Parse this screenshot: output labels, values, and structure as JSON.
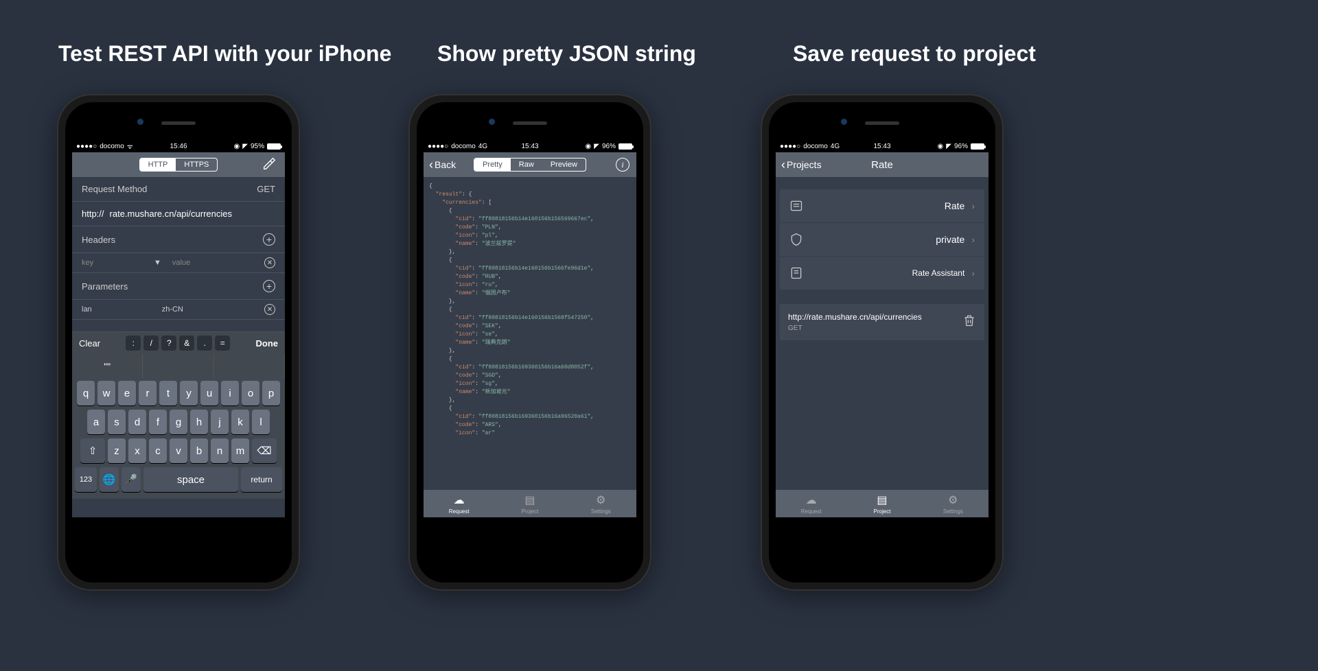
{
  "captions": {
    "c1": "Test REST API with your iPhone",
    "c2": "Show pretty JSON string",
    "c3": "Save request to project"
  },
  "statusbar": {
    "carrier": "docomo",
    "wifi": "wifi",
    "net4g": "4G",
    "time1": "15:46",
    "time2": "15:43",
    "time3": "15:43",
    "battery1": "95%",
    "battery2": "96%",
    "battery3": "96%"
  },
  "phone1": {
    "http": "HTTP",
    "https": "HTTPS",
    "request_method": "Request Method",
    "method_value": "GET",
    "scheme": "http://",
    "url": "rate.mushare.cn/api/currencies",
    "headers": "Headers",
    "key_placeholder": "key",
    "value_placeholder": "value",
    "parameters": "Parameters",
    "param_key": "lan",
    "param_value": "zh-CN",
    "clear": "Clear",
    "done": "Done",
    "qkeys": [
      ":",
      "/",
      "?",
      "&",
      ".",
      "="
    ],
    "candidate": "\"\"",
    "kb": {
      "r1": [
        "q",
        "w",
        "e",
        "r",
        "t",
        "y",
        "u",
        "i",
        "o",
        "p"
      ],
      "r2": [
        "a",
        "s",
        "d",
        "f",
        "g",
        "h",
        "j",
        "k",
        "l"
      ],
      "r3": [
        "z",
        "x",
        "c",
        "v",
        "b",
        "n",
        "m"
      ],
      "num": "123",
      "space": "space",
      "return": "return"
    }
  },
  "phone2": {
    "back": "Back",
    "pretty": "Pretty",
    "raw": "Raw",
    "preview": "Preview",
    "json": {
      "result": {
        "currencies": [
          {
            "cid": "ff80818156b14e160156b156569667ec",
            "code": "PLN",
            "icon": "pl",
            "name": "波兰兹罗提"
          },
          {
            "cid": "ff80818156b14e160156b1566fe96d1e",
            "code": "RUB",
            "icon": "ru",
            "name": "俄国卢布"
          },
          {
            "cid": "ff80818156b14e160156b1568f547250",
            "code": "SEK",
            "icon": "se",
            "name": "瑞典克朗"
          },
          {
            "cid": "ff80818156b169360156b16a60d8052f",
            "code": "SGD",
            "icon": "sg",
            "name": "新加坡元"
          },
          {
            "cid": "ff80818156b169360156b16a96520a61",
            "code": "ARS",
            "icon": "ar"
          }
        ]
      }
    },
    "tabs": {
      "request": "Request",
      "project": "Project",
      "settings": "Settings"
    }
  },
  "phone3": {
    "projects": "Projects",
    "title": "Rate",
    "items": [
      {
        "label": "Rate"
      },
      {
        "label": "private"
      },
      {
        "label": "Rate Assistant"
      }
    ],
    "request_url": "http://rate.mushare.cn/api/currencies",
    "request_method": "GET",
    "tabs": {
      "request": "Request",
      "project": "Project",
      "settings": "Settings"
    }
  }
}
